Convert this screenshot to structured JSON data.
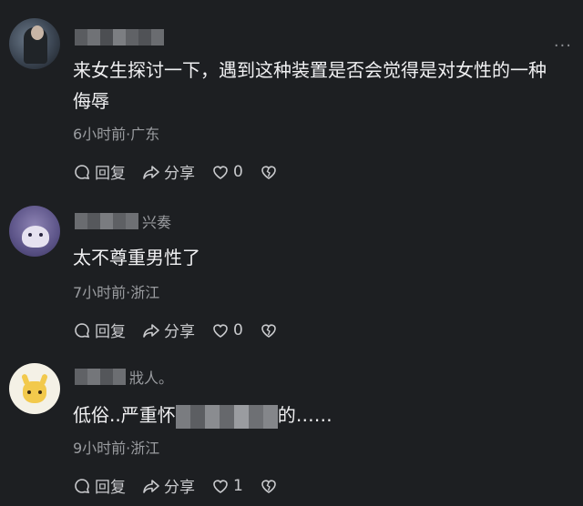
{
  "comments": [
    {
      "name_tail": "",
      "text_lines": [
        "来女生探讨一下，遇到这种装置是否会觉得是对女性的一种",
        "侮辱"
      ],
      "meta": "6小时前·广东",
      "reply_label": "回复",
      "share_label": "分享",
      "like_count": "0"
    },
    {
      "name_tail": "兴奏",
      "text_lines": [
        "太不尊重男性了"
      ],
      "meta": "7小时前·浙江",
      "reply_label": "回复",
      "share_label": "分享",
      "like_count": "0"
    },
    {
      "name_tail": "戕人。",
      "text_prefix": "低俗..严重怀",
      "text_suffix": "的……",
      "meta": "9小时前·浙江",
      "reply_label": "回复",
      "share_label": "分享",
      "like_count": "1"
    }
  ],
  "more_label": "···",
  "icons": [
    "reply-icon",
    "share-icon",
    "like-heart-icon",
    "dislike-heart-icon",
    "more-dots-icon"
  ]
}
